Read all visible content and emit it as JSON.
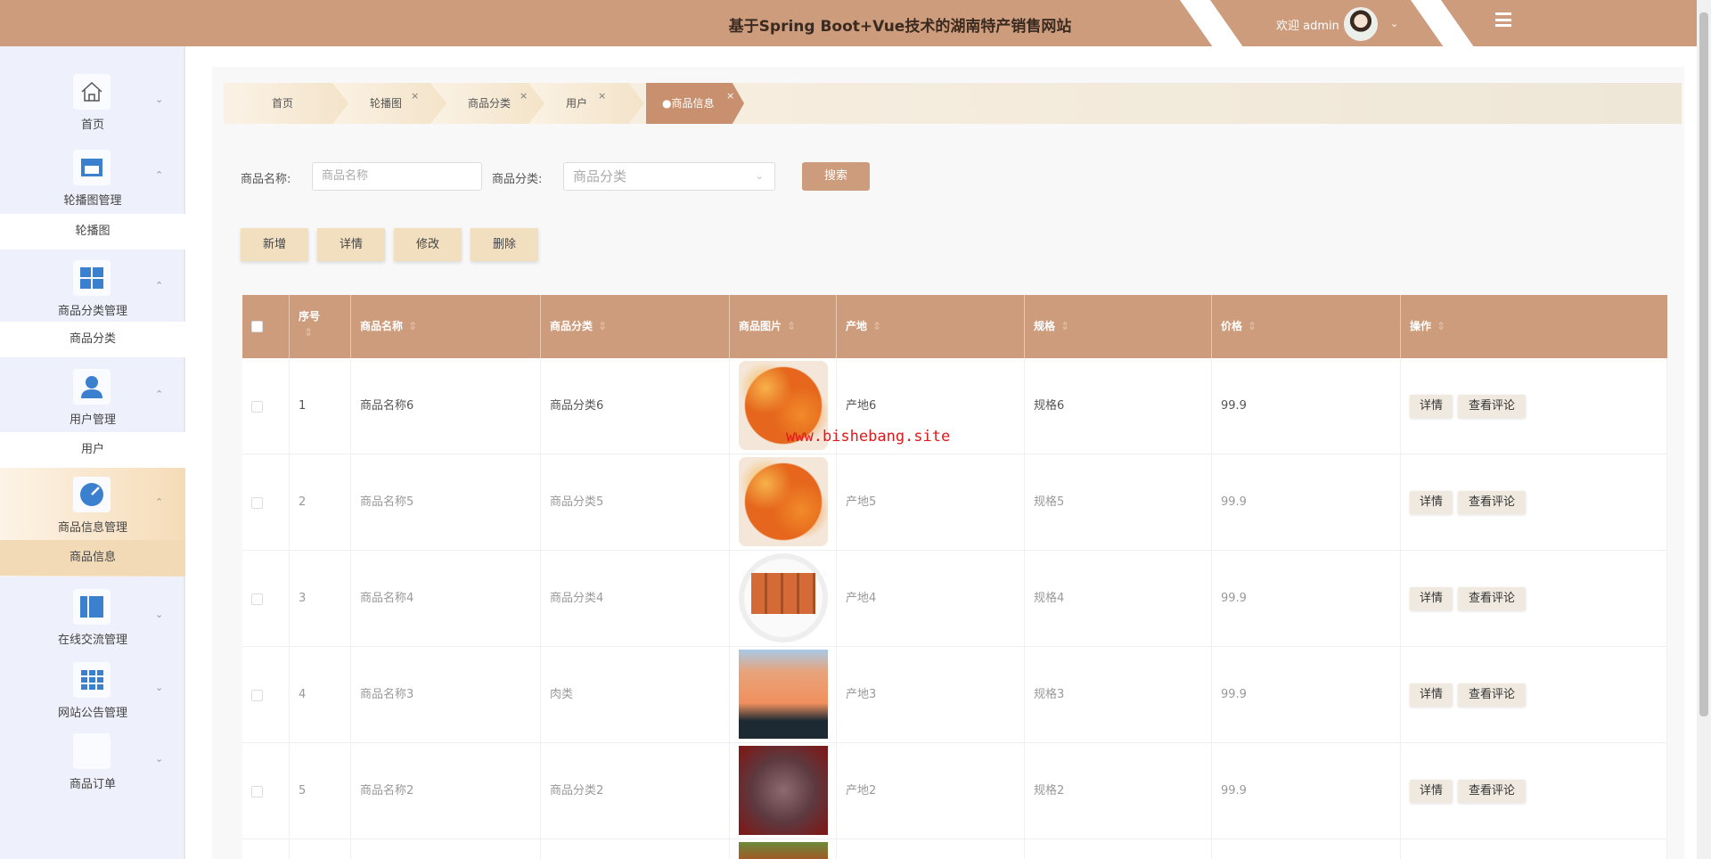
{
  "header": {
    "title": "基于Spring Boot+Vue技术的湖南特产销售网站",
    "welcome": "欢迎 admin",
    "colors": {
      "brand": "#cd9c7c",
      "accent_active": "#c8906f"
    }
  },
  "sidebar": {
    "items": [
      {
        "label": "首页",
        "icon": "home-icon"
      },
      {
        "label": "轮播图管理",
        "icon": "shop-icon",
        "sub": "轮播图"
      },
      {
        "label": "商品分类管理",
        "icon": "grid-icon",
        "sub": "商品分类"
      },
      {
        "label": "用户管理",
        "icon": "user-icon",
        "sub": "用户"
      },
      {
        "label": "商品信息管理",
        "icon": "gauge-icon",
        "sub": "商品信息"
      },
      {
        "label": "在线交流管理",
        "icon": "panel-icon"
      },
      {
        "label": "网站公告管理",
        "icon": "apps-icon"
      },
      {
        "label": "商品订单",
        "icon": "blank-icon"
      }
    ]
  },
  "tabs": [
    {
      "label": "首页"
    },
    {
      "label": "轮播图"
    },
    {
      "label": "商品分类"
    },
    {
      "label": "用户"
    },
    {
      "label": "●商品信息"
    }
  ],
  "search": {
    "name_label": "商品名称:",
    "name_placeholder": "商品名称",
    "category_label": "商品分类:",
    "category_placeholder": "商品分类",
    "button": "搜索"
  },
  "actions": {
    "add": "新增",
    "detail": "详情",
    "edit": "修改",
    "delete": "删除"
  },
  "table": {
    "columns": [
      "序号",
      "商品名称",
      "商品分类",
      "商品图片",
      "产地",
      "规格",
      "价格",
      "操作"
    ],
    "rows": [
      {
        "no": "1",
        "name": "商品名称6",
        "category": "商品分类6",
        "origin": "产地6",
        "spec": "规格6",
        "price": "99.9"
      },
      {
        "no": "2",
        "name": "商品名称5",
        "category": "商品分类5",
        "origin": "产地5",
        "spec": "规格5",
        "price": "99.9"
      },
      {
        "no": "3",
        "name": "商品名称4",
        "category": "商品分类4",
        "origin": "产地4",
        "spec": "规格4",
        "price": "99.9"
      },
      {
        "no": "4",
        "name": "商品名称3",
        "category": "肉类",
        "origin": "产地3",
        "spec": "规格3",
        "price": "99.9"
      },
      {
        "no": "5",
        "name": "商品名称2",
        "category": "商品分类2",
        "origin": "产地2",
        "spec": "规格2",
        "price": "99.9"
      }
    ],
    "row_detail": "详情",
    "row_comments": "查看评论"
  },
  "watermark": "www.bishebang.site"
}
